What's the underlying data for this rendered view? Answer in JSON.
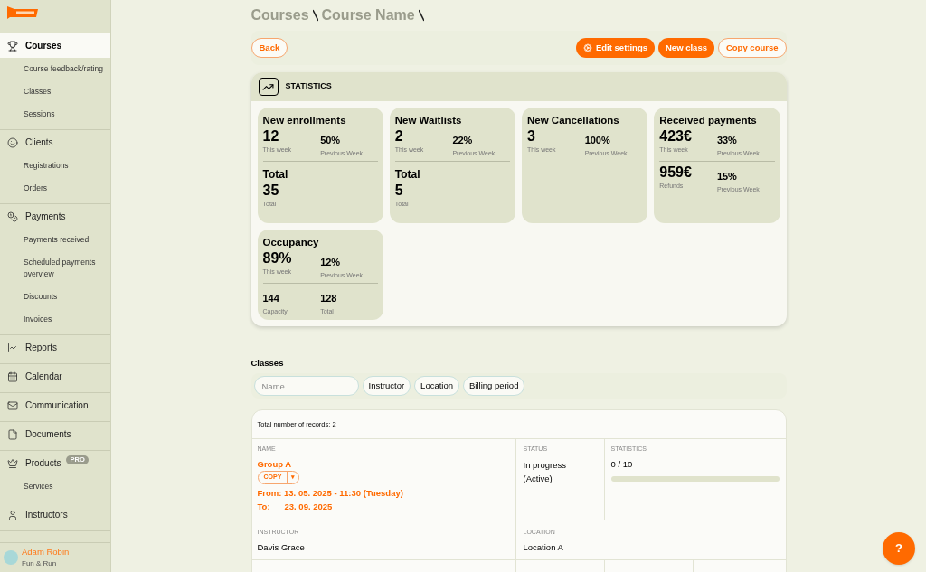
{
  "sidebar": {
    "sections": [
      {
        "label": "Courses",
        "selected": true,
        "children": [
          {
            "label": "Course feedback/rating"
          },
          {
            "label": "Classes"
          },
          {
            "label": "Sessions"
          }
        ]
      },
      {
        "label": "Clients",
        "selected": false,
        "children": [
          {
            "label": "Registrations"
          },
          {
            "label": "Orders"
          }
        ]
      },
      {
        "label": "Payments",
        "selected": false,
        "children": [
          {
            "label": "Payments received"
          },
          {
            "label": "Scheduled payments overview"
          },
          {
            "label": "Discounts"
          },
          {
            "label": "Invoices"
          }
        ]
      },
      {
        "label": "Reports",
        "selected": false
      },
      {
        "label": "Calendar",
        "selected": false
      },
      {
        "label": "Communication",
        "selected": false
      },
      {
        "label": "Documents",
        "selected": false
      },
      {
        "label": "Products",
        "selected": false,
        "badge": "PRO",
        "children": [
          {
            "label": "Services"
          }
        ]
      },
      {
        "label": "Instructors",
        "selected": false
      }
    ],
    "user": {
      "name": "Adam Robin",
      "org": "Fun & Run"
    }
  },
  "breadcrumb": [
    "Courses",
    "Course Name"
  ],
  "toolbar": {
    "back": "Back",
    "actions": [
      {
        "label": "Edit settings",
        "kind": "settings"
      },
      {
        "label": "New class",
        "kind": "filled"
      },
      {
        "label": "Copy course",
        "kind": "outline"
      }
    ]
  },
  "statistics": {
    "title": "STATISTICS",
    "tiles": [
      {
        "title": "New enrollments",
        "rows": [
          [
            {
              "value": "12",
              "caption": "This week",
              "kind": "big"
            },
            {
              "value": "50%",
              "caption": "Previous Week",
              "kind": "small"
            }
          ],
          [
            {
              "value": "Total",
              "kind": "heading"
            }
          ],
          [
            {
              "value": "35",
              "caption": "Total",
              "kind": "big"
            }
          ]
        ]
      },
      {
        "title": "New Waitlists",
        "rows": [
          [
            {
              "value": "2",
              "caption": "This week",
              "kind": "big"
            },
            {
              "value": "22%",
              "caption": "Previous Week",
              "kind": "small"
            }
          ],
          [
            {
              "value": "Total",
              "kind": "heading"
            }
          ],
          [
            {
              "value": "5",
              "caption": "Total",
              "kind": "big"
            }
          ]
        ]
      },
      {
        "title": "New Cancellations",
        "rows": [
          [
            {
              "value": "3",
              "caption": "This week",
              "kind": "big"
            },
            {
              "value": "100%",
              "caption": "Previous Week",
              "kind": "small"
            }
          ]
        ]
      },
      {
        "title": "Received payments",
        "rows": [
          [
            {
              "value": "423€",
              "caption": "This week",
              "kind": "big"
            },
            {
              "value": "33%",
              "caption": "Previous Week",
              "kind": "small"
            }
          ],
          [
            {
              "value": "959€",
              "caption": "Refunds",
              "kind": "big"
            },
            {
              "value": "15%",
              "caption": "Previous Week",
              "kind": "small"
            }
          ]
        ]
      },
      {
        "title": "Occupancy",
        "rows": [
          [
            {
              "value": "89%",
              "caption": "This week",
              "kind": "big"
            },
            {
              "value": "12%",
              "caption": "Previous Week",
              "kind": "small"
            }
          ],
          [
            {
              "value": "144",
              "caption": "Capacity",
              "kind": "small"
            },
            {
              "value": "128",
              "caption": "Total",
              "kind": "small"
            }
          ]
        ]
      }
    ]
  },
  "classes": {
    "title": "Classes",
    "filters": {
      "placeholder": "Name",
      "chips": [
        "Instructor",
        "Location",
        "Billing period"
      ]
    },
    "total": "Total number of records: 2",
    "row": {
      "name_label": "NAME",
      "name": "Group A",
      "copy": "COPY",
      "caret": "▾",
      "from": "From: 13. 05. 2025 - 11:30 (Tuesday)",
      "to_label": "To:",
      "to": "23. 09. 2025",
      "status_label": "STATUS",
      "status": "In progress (Active)",
      "stats_label": "STATISTICS",
      "stats": "0 / 10",
      "instructor_label": "INSTRUCTOR",
      "instructor": "Davis Grace",
      "location_label": "LOCATION",
      "location": "Location A"
    }
  },
  "help": "?"
}
